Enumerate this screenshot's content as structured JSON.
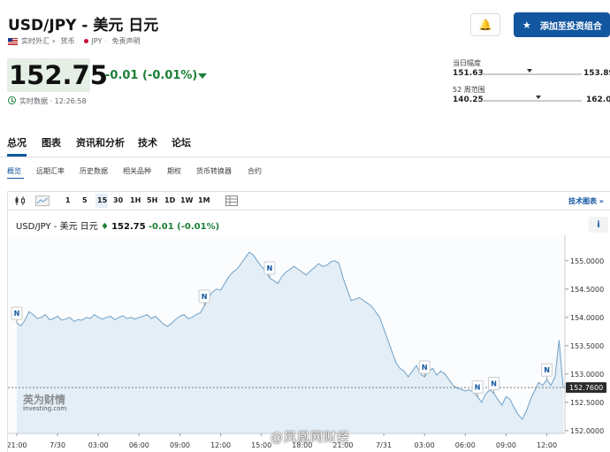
{
  "header": {
    "title": "USD/JPY - 美元 日元",
    "sub_items": [
      "实时外汇",
      "货币",
      "JPY",
      "免责声明"
    ],
    "price": "152.75",
    "change": "-0.01 (-0.01%)",
    "status": "实时数据 · 12:26:58",
    "add_button": "添加至投资组合"
  },
  "ranges": {
    "day_label": "当日幅度",
    "day_low": "151.63",
    "day_high": "153.89",
    "day_pos": 0.48,
    "week_label": "52 周范围",
    "week_low": "140.25",
    "week_high": "162.01",
    "week_pos": 0.57
  },
  "tabs": [
    "总况",
    "图表",
    "资讯和分析",
    "技术",
    "论坛"
  ],
  "subtabs": [
    "概览",
    "远期汇率",
    "历史数据",
    "相关品种",
    "期权",
    "货币转换器",
    "合约"
  ],
  "toolbar": {
    "timeframes": [
      "1",
      "5",
      "15",
      "30",
      "1H",
      "5H",
      "1D",
      "1W",
      "1M"
    ],
    "active": "15",
    "tech_link": "技术图表 »"
  },
  "chart_header": {
    "name": "USD/JPY - 美元 日元",
    "price": "152.75",
    "change": "-0.01 (-0.01%)"
  },
  "colors": {
    "accent": "#1256a0",
    "up": "#1a7f37",
    "line": "#6fa0c8",
    "fill": "#e3eef6"
  },
  "watermark": {
    "logo": "英为财情",
    "sub": "Investing.com"
  },
  "weibo": "@凤凰网财经",
  "chart_data": {
    "type": "area",
    "x": [
      0,
      1,
      2,
      3,
      4,
      5,
      6,
      7,
      8,
      9,
      10,
      11,
      12,
      13,
      14,
      15,
      16,
      17,
      18,
      19,
      20,
      21,
      22,
      23,
      24,
      25,
      26,
      27,
      28,
      29,
      30,
      31,
      32,
      33,
      34,
      35,
      36,
      37,
      38,
      39,
      40,
      41,
      42,
      43,
      44,
      45,
      46,
      47,
      48,
      49,
      50,
      51,
      52,
      53,
      54,
      55,
      56,
      57,
      58,
      59,
      60,
      61,
      62,
      63,
      64,
      65,
      66,
      67,
      68,
      69,
      70,
      71,
      72,
      73,
      74,
      75,
      76,
      77,
      78,
      79,
      80,
      81,
      82,
      83,
      84,
      85,
      86,
      87,
      88,
      89,
      90,
      91,
      92,
      93,
      94,
      95,
      96,
      97,
      98,
      99,
      100,
      101,
      102,
      103,
      104,
      105,
      106,
      107,
      108,
      109,
      110,
      111,
      112,
      113,
      114,
      115,
      116,
      117,
      118,
      119,
      120,
      121,
      122,
      123,
      124,
      125,
      126,
      127,
      128,
      129,
      130,
      131,
      132,
      133,
      134
    ],
    "values": [
      153.9,
      153.85,
      153.95,
      154.1,
      154.05,
      153.98,
      154.0,
      154.05,
      153.96,
      153.98,
      154.02,
      153.95,
      153.97,
      154.0,
      153.93,
      153.96,
      153.95,
      154.0,
      153.98,
      154.05,
      154.0,
      153.97,
      154.0,
      154.02,
      153.96,
      154.0,
      154.03,
      153.98,
      154.0,
      153.97,
      154.0,
      154.02,
      154.05,
      153.98,
      154.02,
      153.95,
      153.88,
      153.84,
      153.9,
      153.97,
      154.02,
      154.05,
      153.98,
      154.0,
      154.05,
      154.08,
      154.2,
      154.35,
      154.45,
      154.5,
      154.48,
      154.6,
      154.72,
      154.8,
      154.85,
      154.95,
      155.05,
      155.15,
      155.1,
      155.0,
      154.9,
      154.82,
      154.7,
      154.65,
      154.6,
      154.72,
      154.8,
      154.85,
      154.9,
      154.85,
      154.8,
      154.75,
      154.82,
      154.88,
      154.95,
      154.9,
      154.92,
      154.98,
      155.0,
      154.96,
      154.7,
      154.5,
      154.3,
      154.32,
      154.35,
      154.3,
      154.25,
      154.2,
      154.1,
      154.0,
      153.8,
      153.6,
      153.4,
      153.2,
      153.1,
      153.05,
      152.95,
      153.05,
      153.15,
      153.0,
      152.95,
      153.05,
      153.1,
      152.98,
      153.05,
      153.0,
      152.9,
      152.8,
      152.75,
      152.73,
      152.7,
      152.72,
      152.68,
      152.6,
      152.5,
      152.65,
      152.72,
      152.66,
      152.55,
      152.45,
      152.6,
      152.55,
      152.4,
      152.28,
      152.2,
      152.35,
      152.55,
      152.7,
      152.85,
      152.8,
      152.9,
      152.8,
      152.95,
      153.6,
      152.76
    ],
    "ylim": [
      151.95,
      155.45
    ],
    "y_ticks": [
      152.0,
      152.5,
      153.0,
      153.5,
      154.0,
      154.5,
      155.0
    ],
    "y_tick_labels": [
      "152.0000",
      "152.5000",
      "153.0000",
      "153.5000",
      "154.0000",
      "154.5000",
      "155.0000"
    ],
    "current_value": 152.76,
    "current_label": "152.7600",
    "x_ticks": [
      0,
      10,
      20,
      30,
      40,
      50,
      60,
      70,
      80,
      90,
      100,
      110,
      120,
      130
    ],
    "x_tick_labels": [
      "21:00",
      "7/30",
      "03:00",
      "06:00",
      "09:00",
      "12:00",
      "15:00",
      "18:00",
      "21:00",
      "7/31",
      "03:00",
      "06:00",
      "09:00",
      "12:00"
    ],
    "news_markers": [
      {
        "x": 0,
        "label": "N"
      },
      {
        "x": 46,
        "label": "N"
      },
      {
        "x": 62,
        "label": "N"
      },
      {
        "x": 100,
        "label": "N"
      },
      {
        "x": 113,
        "label": "N"
      },
      {
        "x": 117,
        "label": "N"
      },
      {
        "x": 130,
        "label": "N"
      }
    ]
  }
}
